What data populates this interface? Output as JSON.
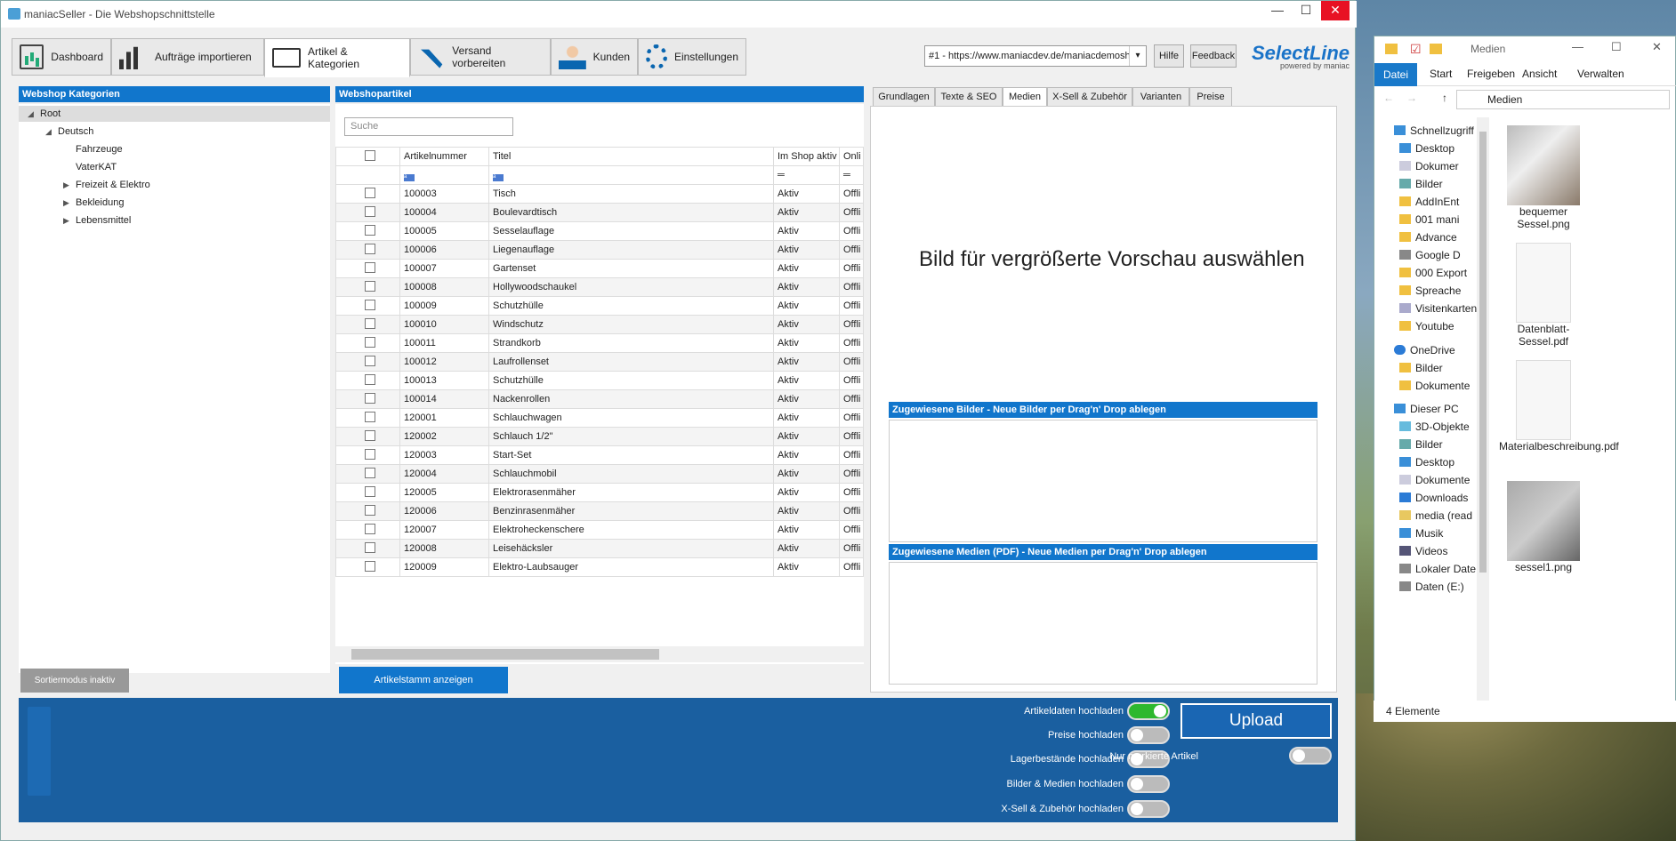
{
  "app": {
    "title": "maniacSeller - Die Webshopschnittstelle"
  },
  "window_controls": {
    "minimize": "—",
    "maximize": "☐",
    "close": "✕"
  },
  "toolbar": {
    "tabs": [
      {
        "label": "Dashboard",
        "icon": "dashboard-icon"
      },
      {
        "label": "Aufträge importieren",
        "icon": "chart-bars-icon"
      },
      {
        "label": "Artikel & Kategorien",
        "icon": "monitor-add-icon"
      },
      {
        "label": "Versand vorbereiten",
        "icon": "hand-truck-icon"
      },
      {
        "label": "Kunden",
        "icon": "customers-icon"
      },
      {
        "label": "Einstellungen",
        "icon": "gears-icon"
      }
    ],
    "shop_url": "#1 - https://www.maniacdev.de/maniacdemosh",
    "help": "Hilfe",
    "feedback": "Feedback"
  },
  "logo": {
    "name": "SelectLine",
    "sub": "powered by maniac"
  },
  "categories": {
    "header": "Webshop Kategorien",
    "nodes": [
      "Root",
      "Deutsch",
      "Fahrzeuge",
      "VaterKAT",
      "Freizeit & Elektro",
      "Bekleidung",
      "Lebensmittel"
    ],
    "sort_mode": "Sortiermodus inaktiv"
  },
  "articles": {
    "header": "Webshopartikel",
    "search_placeholder": "Suche",
    "columns": [
      "Artikelnummer",
      "Titel",
      "Im Shop aktiv",
      "Onli"
    ],
    "filter_glyph": "a",
    "rows": [
      [
        "100003",
        "Tisch",
        "Aktiv",
        "Offli"
      ],
      [
        "100004",
        "Boulevardtisch",
        "Aktiv",
        "Offli"
      ],
      [
        "100005",
        "Sesselauflage",
        "Aktiv",
        "Offli"
      ],
      [
        "100006",
        "Liegenauflage",
        "Aktiv",
        "Offli"
      ],
      [
        "100007",
        "Gartenset",
        "Aktiv",
        "Offli"
      ],
      [
        "100008",
        "Hollywoodschaukel",
        "Aktiv",
        "Offli"
      ],
      [
        "100009",
        "Schutzhülle",
        "Aktiv",
        "Offli"
      ],
      [
        "100010",
        "Windschutz",
        "Aktiv",
        "Offli"
      ],
      [
        "100011",
        "Strandkorb",
        "Aktiv",
        "Offli"
      ],
      [
        "100012",
        "Laufrollenset",
        "Aktiv",
        "Offli"
      ],
      [
        "100013",
        "Schutzhülle",
        "Aktiv",
        "Offli"
      ],
      [
        "100014",
        "Nackenrollen",
        "Aktiv",
        "Offli"
      ],
      [
        "120001",
        "Schlauchwagen",
        "Aktiv",
        "Offli"
      ],
      [
        "120002",
        "Schlauch 1/2\"",
        "Aktiv",
        "Offli"
      ],
      [
        "120003",
        "Start-Set",
        "Aktiv",
        "Offli"
      ],
      [
        "120004",
        "Schlauchmobil",
        "Aktiv",
        "Offli"
      ],
      [
        "120005",
        "Elektrorasenmäher",
        "Aktiv",
        "Offli"
      ],
      [
        "120006",
        "Benzinrasenmäher",
        "Aktiv",
        "Offli"
      ],
      [
        "120007",
        "Elektroheckenschere",
        "Aktiv",
        "Offli"
      ],
      [
        "120008",
        "Leisehäcksler",
        "Aktiv",
        "Offli"
      ],
      [
        "120009",
        "Elektro-Laubsauger",
        "Aktiv",
        "Offli"
      ]
    ],
    "show_master": "Artikelstamm anzeigen"
  },
  "detail": {
    "tabs": [
      "Grundlagen",
      "Texte & SEO",
      "Medien",
      "X-Sell & Zubehör",
      "Varianten",
      "Preise"
    ],
    "preview_text": "Bild für vergrößerte Vorschau auswählen",
    "images_header": "Zugewiesene Bilder - Neue Bilder per Drag'n' Drop ablegen",
    "media_header": "Zugewiesene Medien (PDF) - Neue Medien per Drag'n' Drop ablegen"
  },
  "upload": {
    "options": [
      {
        "label": "Artikeldaten hochladen",
        "on": true
      },
      {
        "label": "Preise hochladen",
        "on": false
      },
      {
        "label": "Lagerbestände hochladen",
        "on": false
      },
      {
        "label": "Bilder & Medien hochladen",
        "on": false
      },
      {
        "label": "X-Sell & Zubehör hochladen",
        "on": false
      }
    ],
    "button": "Upload",
    "only_marked": "Nur markierte Artikel"
  },
  "explorer": {
    "title": "Medien",
    "ribbon": [
      "Datei",
      "Start",
      "Freigeben",
      "Ansicht",
      "Verwalten"
    ],
    "address": "Medien",
    "nav": [
      "Schnellzugriff",
      "Desktop",
      "Dokumer",
      "Bilder",
      "AddInEnt",
      "001 mani",
      "Advance",
      "Google D",
      "000 Export",
      "Spreache",
      "Visitenkarten",
      "Youtube",
      "OneDrive",
      "Bilder",
      "Dokumente",
      "Dieser PC",
      "3D-Objekte",
      "Bilder",
      "Desktop",
      "Dokumente",
      "Downloads",
      "media (read",
      "Musik",
      "Videos",
      "Lokaler Date",
      "Daten (E:)"
    ],
    "files": [
      "bequemer Sessel.png",
      "Datenblatt-Sessel.pdf",
      "Materialbeschreibung.pdf",
      "sessel1.png"
    ],
    "status": "4 Elemente"
  }
}
